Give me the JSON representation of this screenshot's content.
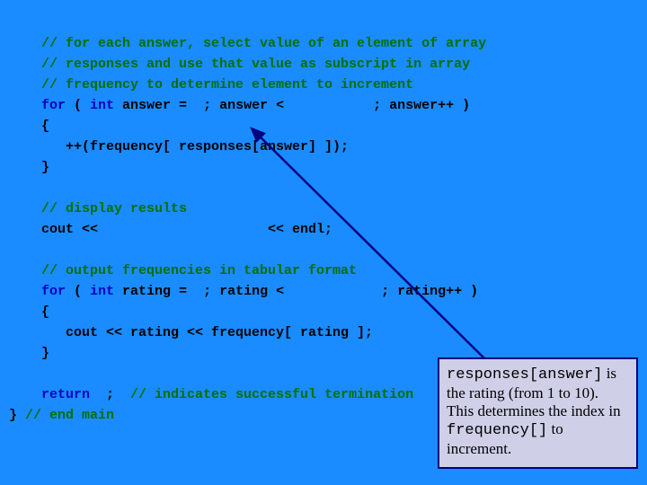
{
  "code": {
    "c1": "// for each answer, select value of an element of array",
    "c2": "// responses and use that value as subscript in array",
    "c3": "// frequency to determine element to increment",
    "l4a": "for",
    "l4b": " ( ",
    "l4c": "int",
    "l4d": " answer =  ; answer <           ; answer++ )",
    "l5": "{",
    "l6": "   ++(frequency[ responses[answer] ]);",
    "l7": "}",
    "blank1": " ",
    "c8": "// display results",
    "l9": "cout <<                     << endl;",
    "blank2": " ",
    "c10": "// output frequencies in tabular format",
    "l11a": "for",
    "l11b": " ( ",
    "l11c": "int",
    "l11d": " rating =  ; rating <            ; rating++ )",
    "l12": "{",
    "l13": "   cout << rating << frequency[ rating ];",
    "l14": "}",
    "blank3": " ",
    "l15a": "return",
    "l15b": "  ;  ",
    "c15": "// indicates successful termination",
    "l16a": "} ",
    "c16": "// end main"
  },
  "annotation": {
    "mono1": "responses[answer]",
    "text1": " is the rating (from 1 to 10). This determines the index in ",
    "mono2": "frequency[]",
    "text2": " to increment."
  }
}
